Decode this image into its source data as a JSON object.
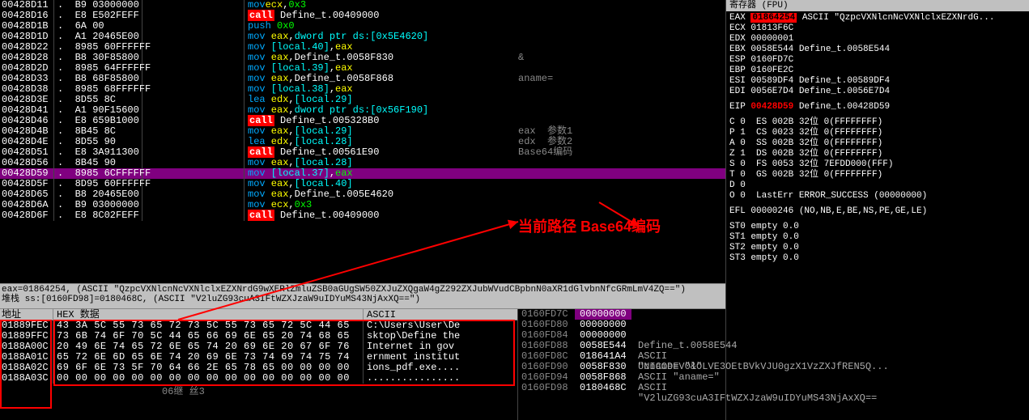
{
  "disasm": [
    {
      "addr": "00428D11",
      "sep": ".  B9 03000000",
      "bytes": "",
      "mn": "mov",
      "mnc": "kw-mov",
      "ops": [
        {
          "t": "ecx",
          "c": "op-reg"
        },
        {
          "t": ",",
          "c": "op-white"
        },
        {
          "t": "0x3",
          "c": "op-lime"
        }
      ],
      "cmt": ""
    },
    {
      "addr": "00428D16",
      "sep": ".  E8 E502FEFF",
      "bytes": "",
      "mn": "call",
      "mnc": "kw-call",
      "ops": [
        {
          "t": " Define_t.00409000",
          "c": "op-white"
        }
      ],
      "cmt": ""
    },
    {
      "addr": "00428D1B",
      "sep": ".  6A 00",
      "bytes": "",
      "mn": "push",
      "mnc": "kw-push",
      "ops": [
        {
          "t": " 0x0",
          "c": "op-lime"
        }
      ],
      "cmt": ""
    },
    {
      "addr": "00428D1D",
      "sep": ".  A1 20465E00",
      "bytes": "",
      "mn": "mov",
      "mnc": "kw-mov",
      "ops": [
        {
          "t": " eax",
          "c": "op-reg"
        },
        {
          "t": ",",
          "c": "op-white"
        },
        {
          "t": "dword ptr ds:[0x5E4620]",
          "c": "op-cyan"
        }
      ],
      "cmt": ""
    },
    {
      "addr": "00428D22",
      "sep": ".  8985 60FFFFFF",
      "bytes": "",
      "mn": "mov",
      "mnc": "kw-mov",
      "ops": [
        {
          "t": " [local.40]",
          "c": "op-cyan"
        },
        {
          "t": ",",
          "c": "op-white"
        },
        {
          "t": "eax",
          "c": "op-reg"
        }
      ],
      "cmt": ""
    },
    {
      "addr": "00428D28",
      "sep": ".  B8 30F85800",
      "bytes": "",
      "mn": "mov",
      "mnc": "kw-mov",
      "ops": [
        {
          "t": " eax",
          "c": "op-reg"
        },
        {
          "t": ",",
          "c": "op-white"
        },
        {
          "t": "Define_t.0058F830",
          "c": "op-white"
        }
      ],
      "cmt": "&"
    },
    {
      "addr": "00428D2D",
      "sep": ".  8985 64FFFFFF",
      "bytes": "",
      "mn": "mov",
      "mnc": "kw-mov",
      "ops": [
        {
          "t": " [local.39]",
          "c": "op-cyan"
        },
        {
          "t": ",",
          "c": "op-white"
        },
        {
          "t": "eax",
          "c": "op-reg"
        }
      ],
      "cmt": ""
    },
    {
      "addr": "00428D33",
      "sep": ".  B8 68F85800",
      "bytes": "",
      "mn": "mov",
      "mnc": "kw-mov",
      "ops": [
        {
          "t": " eax",
          "c": "op-reg"
        },
        {
          "t": ",",
          "c": "op-white"
        },
        {
          "t": "Define_t.0058F868",
          "c": "op-white"
        }
      ],
      "cmt": "aname="
    },
    {
      "addr": "00428D38",
      "sep": ".  8985 68FFFFFF",
      "bytes": "",
      "mn": "mov",
      "mnc": "kw-mov",
      "ops": [
        {
          "t": " [local.38]",
          "c": "op-cyan"
        },
        {
          "t": ",",
          "c": "op-white"
        },
        {
          "t": "eax",
          "c": "op-reg"
        }
      ],
      "cmt": ""
    },
    {
      "addr": "00428D3E",
      "sep": ".  8D55 8C",
      "bytes": "",
      "mn": "lea",
      "mnc": "kw-lea",
      "ops": [
        {
          "t": " edx",
          "c": "op-reg"
        },
        {
          "t": ",",
          "c": "op-white"
        },
        {
          "t": "[local.29]",
          "c": "op-cyan"
        }
      ],
      "cmt": ""
    },
    {
      "addr": "00428D41",
      "sep": ".  A1 90F15600",
      "bytes": "",
      "mn": "mov",
      "mnc": "kw-mov",
      "ops": [
        {
          "t": " eax",
          "c": "op-reg"
        },
        {
          "t": ",",
          "c": "op-white"
        },
        {
          "t": "dword ptr ds:[0x56F190]",
          "c": "op-cyan"
        }
      ],
      "cmt": ""
    },
    {
      "addr": "00428D46",
      "sep": ".  E8 659B1000",
      "bytes": "",
      "mn": "call",
      "mnc": "kw-call",
      "ops": [
        {
          "t": " Define_t.005328B0",
          "c": "op-white"
        }
      ],
      "cmt": ""
    },
    {
      "addr": "00428D4B",
      "sep": ".  8B45 8C",
      "bytes": "",
      "mn": "mov",
      "mnc": "kw-mov",
      "ops": [
        {
          "t": " eax",
          "c": "op-reg"
        },
        {
          "t": ",",
          "c": "op-white"
        },
        {
          "t": "[local.29]",
          "c": "op-cyan"
        }
      ],
      "cmt": "eax  参数1"
    },
    {
      "addr": "00428D4E",
      "sep": ".  8D55 90",
      "bytes": "",
      "mn": "lea",
      "mnc": "kw-lea",
      "ops": [
        {
          "t": " edx",
          "c": "op-reg"
        },
        {
          "t": ",",
          "c": "op-white"
        },
        {
          "t": "[local.28]",
          "c": "op-cyan"
        }
      ],
      "cmt": "edx  参数2"
    },
    {
      "addr": "00428D51",
      "sep": ".  E8 3A911300",
      "bytes": "",
      "mn": "call",
      "mnc": "kw-call",
      "ops": [
        {
          "t": " Define_t.00561E90",
          "c": "op-white"
        }
      ],
      "cmt": "Base64编码"
    },
    {
      "addr": "00428D56",
      "sep": ".  8B45 90",
      "bytes": "",
      "mn": "mov",
      "mnc": "kw-mov",
      "ops": [
        {
          "t": " eax",
          "c": "op-reg"
        },
        {
          "t": ",",
          "c": "op-white"
        },
        {
          "t": "[local.28]",
          "c": "op-cyan"
        }
      ],
      "cmt": ""
    },
    {
      "addr": "00428D59",
      "sep": ".  8985 6CFFFFFF",
      "bytes": "",
      "mn": "mov",
      "mnc": "kw-mov",
      "ops": [
        {
          "t": " [local.37]",
          "c": "op-cyan"
        },
        {
          "t": ",",
          "c": "op-white"
        },
        {
          "t": "eax",
          "c": "op-lime"
        }
      ],
      "cmt": "",
      "hl": true
    },
    {
      "addr": "00428D5F",
      "sep": ".  8D95 60FFFFFF",
      "bytes": "",
      "mn": "mov",
      "mnc": "kw-mov",
      "ops": [
        {
          "t": " eax",
          "c": "op-reg"
        },
        {
          "t": ",",
          "c": "op-white"
        },
        {
          "t": "[local.40]",
          "c": "op-cyan"
        }
      ],
      "cmt": ""
    },
    {
      "addr": "00428D65",
      "sep": ".  B8 20465E00",
      "bytes": "",
      "mn": "mov",
      "mnc": "kw-mov",
      "ops": [
        {
          "t": " eax",
          "c": "op-reg"
        },
        {
          "t": ",",
          "c": "op-white"
        },
        {
          "t": "Define_t.005E4620",
          "c": "op-white"
        }
      ],
      "cmt": ""
    },
    {
      "addr": "00428D6A",
      "sep": ".  B9 03000000",
      "bytes": "",
      "mn": "mov",
      "mnc": "kw-mov",
      "ops": [
        {
          "t": " ecx",
          "c": "op-reg"
        },
        {
          "t": ",",
          "c": "op-white"
        },
        {
          "t": "0x3",
          "c": "op-lime"
        }
      ],
      "cmt": ""
    },
    {
      "addr": "00428D6F",
      "sep": ".  E8 8C02FEFF",
      "bytes": "",
      "mn": "call",
      "mnc": "kw-call",
      "ops": [
        {
          "t": " Define_t.00409000",
          "c": "op-white"
        }
      ],
      "cmt": ""
    }
  ],
  "infobar": {
    "line1": "eax=01864254, (ASCII \"QzpcVXNlcnNcVXNlclxEZXNrdG9wXERlZmluZSB0aGUgSW50ZXJuZXQgaW4gZ292ZXJubWVudCBpbnN0aXR1dGlvbnNfcGRmLmV4ZQ==\")",
    "line2": "堆栈 ss:[0160FD98]=0180468C, (ASCII \"V2luZG93cuA3IFtWZXJzaW9uIDYuMS43NjAxXQ==\")"
  },
  "hex": {
    "hdr_addr": "地址",
    "hdr_bytes": "HEX 数据",
    "hdr_ascii": "ASCII",
    "rows": [
      {
        "a": "01889FEC",
        "b": "43 3A 5C 55 73 65 72 73 5C 55 73 65 72 5C 44 65",
        "s": "C:\\Users\\User\\De"
      },
      {
        "a": "01889FFC",
        "b": "73 6B 74 6F 70 5C 44 65 66 69 6E 65 20 74 68 65",
        "s": "sktop\\Define the"
      },
      {
        "a": "0188A00C",
        "b": "20 49 6E 74 65 72 6E 65 74 20 69 6E 20 67 6F 76",
        "s": " Internet in gov"
      },
      {
        "a": "0188A01C",
        "b": "65 72 6E 6D 65 6E 74 20 69 6E 73 74 69 74 75 74",
        "s": "ernment institut"
      },
      {
        "a": "0188A02C",
        "b": "69 6F 6E 73 5F 70 64 66 2E 65 78 65 00 00 00 00",
        "s": "ions_pdf.exe...."
      },
      {
        "a": "0188A03C",
        "b": "00 00 00 00 00 00 00 00 00 00 00 00 00 00 00 00",
        "s": "................"
      }
    ],
    "footer": "06继 丝3"
  },
  "stack": [
    {
      "a": "0160FD7C",
      "v": "00000000",
      "c": "",
      "hl": true
    },
    {
      "a": "0160FD80",
      "v": "00000000",
      "c": ""
    },
    {
      "a": "0160FD84",
      "v": "00000000",
      "c": ""
    },
    {
      "a": "0160FD88",
      "v": "0058E544",
      "c": "Define_t.0058E544"
    },
    {
      "a": "0160FD8C",
      "v": "018641A4",
      "c": "ASCII \"cname=V0lOLVE3OEtBVkVJU0gzX1VzZXJfREN5Q..."
    },
    {
      "a": "0160FD90",
      "v": "0058F830",
      "c": "UNICODE \"&\""
    },
    {
      "a": "0160FD94",
      "v": "0058F868",
      "c": "ASCII \"aname=\""
    },
    {
      "a": "0160FD98",
      "v": "0180468C",
      "c": "ASCII \"V2luZG93cuA3IFtWZXJzaW9uIDYuMS43NjAxXQ=="
    }
  ],
  "regs": {
    "title": "寄存器 (FPU)",
    "gpr": [
      {
        "n": "EAX",
        "v": "01864254",
        "hl": true,
        "d": "ASCII \"QzpcVXNlcnNcVXNlclxEZXNrdG..."
      },
      {
        "n": "ECX",
        "v": "01813F6C",
        "d": ""
      },
      {
        "n": "EDX",
        "v": "00000001",
        "d": ""
      },
      {
        "n": "EBX",
        "v": "0058E544",
        "d": "Define_t.0058E544"
      },
      {
        "n": "ESP",
        "v": "0160FD7C",
        "d": ""
      },
      {
        "n": "EBP",
        "v": "0160FE2C",
        "d": ""
      },
      {
        "n": "ESI",
        "v": "00589DF4",
        "d": "Define_t.00589DF4"
      },
      {
        "n": "EDI",
        "v": "0056E7D4",
        "d": "Define_t.0056E7D4"
      }
    ],
    "eip": {
      "n": "EIP",
      "v": "00428D59",
      "d": "Define_t.00428D59"
    },
    "flags": [
      "C 0  ES 002B 32位 0(FFFFFFFF)",
      "P 1  CS 0023 32位 0(FFFFFFFF)",
      "A 0  SS 002B 32位 0(FFFFFFFF)",
      "Z 1  DS 002B 32位 0(FFFFFFFF)",
      "S 0  FS 0053 32位 7EFDD000(FFF)",
      "T 0  GS 002B 32位 0(FFFFFFFF)",
      "D 0",
      "O 0  LastErr ERROR_SUCCESS (00000000)"
    ],
    "efl": "EFL 00000246 (NO,NB,E,BE,NS,PE,GE,LE)",
    "fpu": [
      "ST0 empty 0.0",
      "ST1 empty 0.0",
      "ST2 empty 0.0",
      "ST3 empty 0.0"
    ]
  },
  "annotation": "当前路径 Base64编码"
}
